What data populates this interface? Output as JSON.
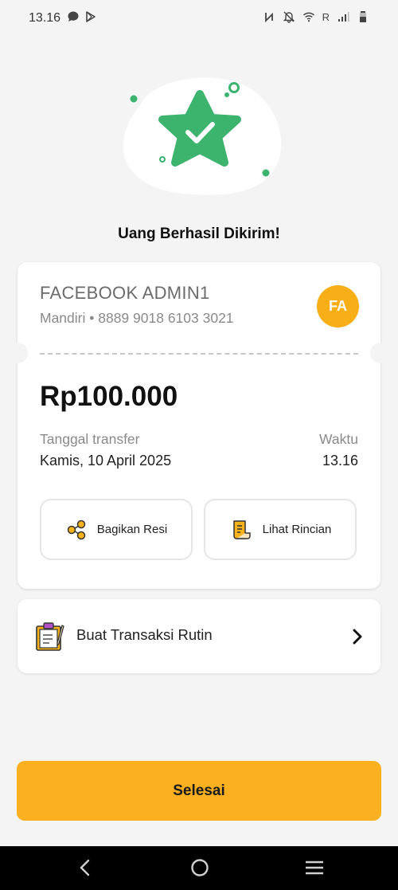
{
  "status_bar": {
    "time": "13.16",
    "left_icons": [
      "chat-bubble-icon",
      "play-store-icon"
    ],
    "right_icons": [
      "nfc-icon",
      "bell-off-icon",
      "wifi-icon",
      "roaming-r-icon",
      "signal-icon",
      "battery-icon"
    ],
    "roaming_label": "R"
  },
  "success": {
    "title": "Uang Berhasil Dikirim!",
    "illustration_icon": "star-check-icon",
    "colors": {
      "star": "#3cb46e",
      "blob": "#ffffff"
    }
  },
  "receipt": {
    "recipient_name": "FACEBOOK ADMIN1",
    "recipient_account": "Mandiri • 8889 9018 6103 3021",
    "avatar_initials": "FA",
    "amount": "Rp100.000",
    "date_label": "Tanggal transfer",
    "date_value": "Kamis, 10 April 2025",
    "time_label": "Waktu",
    "time_value": "13.16",
    "actions": [
      {
        "label": "Bagikan Resi",
        "icon": "share-icon"
      },
      {
        "label": "Lihat Rincian",
        "icon": "receipt-icon"
      }
    ]
  },
  "routine": {
    "label": "Buat Transaksi Rutin",
    "icon": "clipboard-icon",
    "chevron": "chevron-right-icon"
  },
  "finish_button": {
    "label": "Selesai",
    "color": "#fbb022"
  },
  "nav_bar": {
    "icons": [
      "back-icon",
      "home-icon",
      "recents-icon"
    ]
  },
  "colors": {
    "accent": "#fbb022",
    "avatar": "#f8ae16",
    "background": "#f4f4f4"
  }
}
